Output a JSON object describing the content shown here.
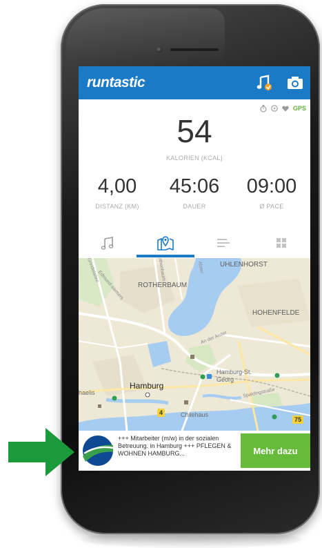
{
  "app": {
    "logo": "runtastic",
    "icons": {
      "music": "music-note-icon",
      "camera": "camera-icon"
    }
  },
  "status": {
    "icons": [
      "stopwatch-icon",
      "compass-icon",
      "heart-icon"
    ],
    "gps": "GPS"
  },
  "stats": {
    "calories": {
      "value": "54",
      "label": "KALORIEN (KCAL)"
    },
    "distance": {
      "value": "4,00",
      "label": "DISTANZ (KM)"
    },
    "duration": {
      "value": "45:06",
      "label": "DAUER"
    },
    "pace": {
      "value": "09:00",
      "label": "Ø PACE"
    }
  },
  "tabs": [
    {
      "icon": "music-icon",
      "selected": false
    },
    {
      "icon": "map-pin-icon",
      "selected": true
    },
    {
      "icon": "list-icon",
      "selected": false
    },
    {
      "icon": "grid-icon",
      "selected": false
    }
  ],
  "map": {
    "labels": {
      "uhlenhorst": "UHLENHORST",
      "rotherbaum": "ROTHERBAUM",
      "hohenfelde": "HOHENFELDE",
      "hamburg_st_georg": "Hamburg-St.\nGeorg",
      "hamburg": "Hamburg",
      "michaelis": "haelis",
      "chilehaus": "Chilehaus",
      "an_der_alster": "An der Alster",
      "spaldingstrasse": "Spaldingstraße",
      "grindelallee": "Grindelallee",
      "rothenbaum_road": "Rothenbaum",
      "edmund_road": "Edmund-siemers",
      "alster_road": "Alster"
    },
    "shields": {
      "b4": "4",
      "b75": "75"
    }
  },
  "ad": {
    "text": "+++ Mitarbeiter (m/w) in der sozialen Betreuung. in Hamburg +++ PFLEGEN & WOHNEN HAMBURG...",
    "button": "Mehr dazu"
  },
  "colors": {
    "brand_blue": "#1a7ac6",
    "gps_green": "#62b33c",
    "ad_button": "#66bb3a",
    "arrow_green": "#1a9a3a"
  }
}
